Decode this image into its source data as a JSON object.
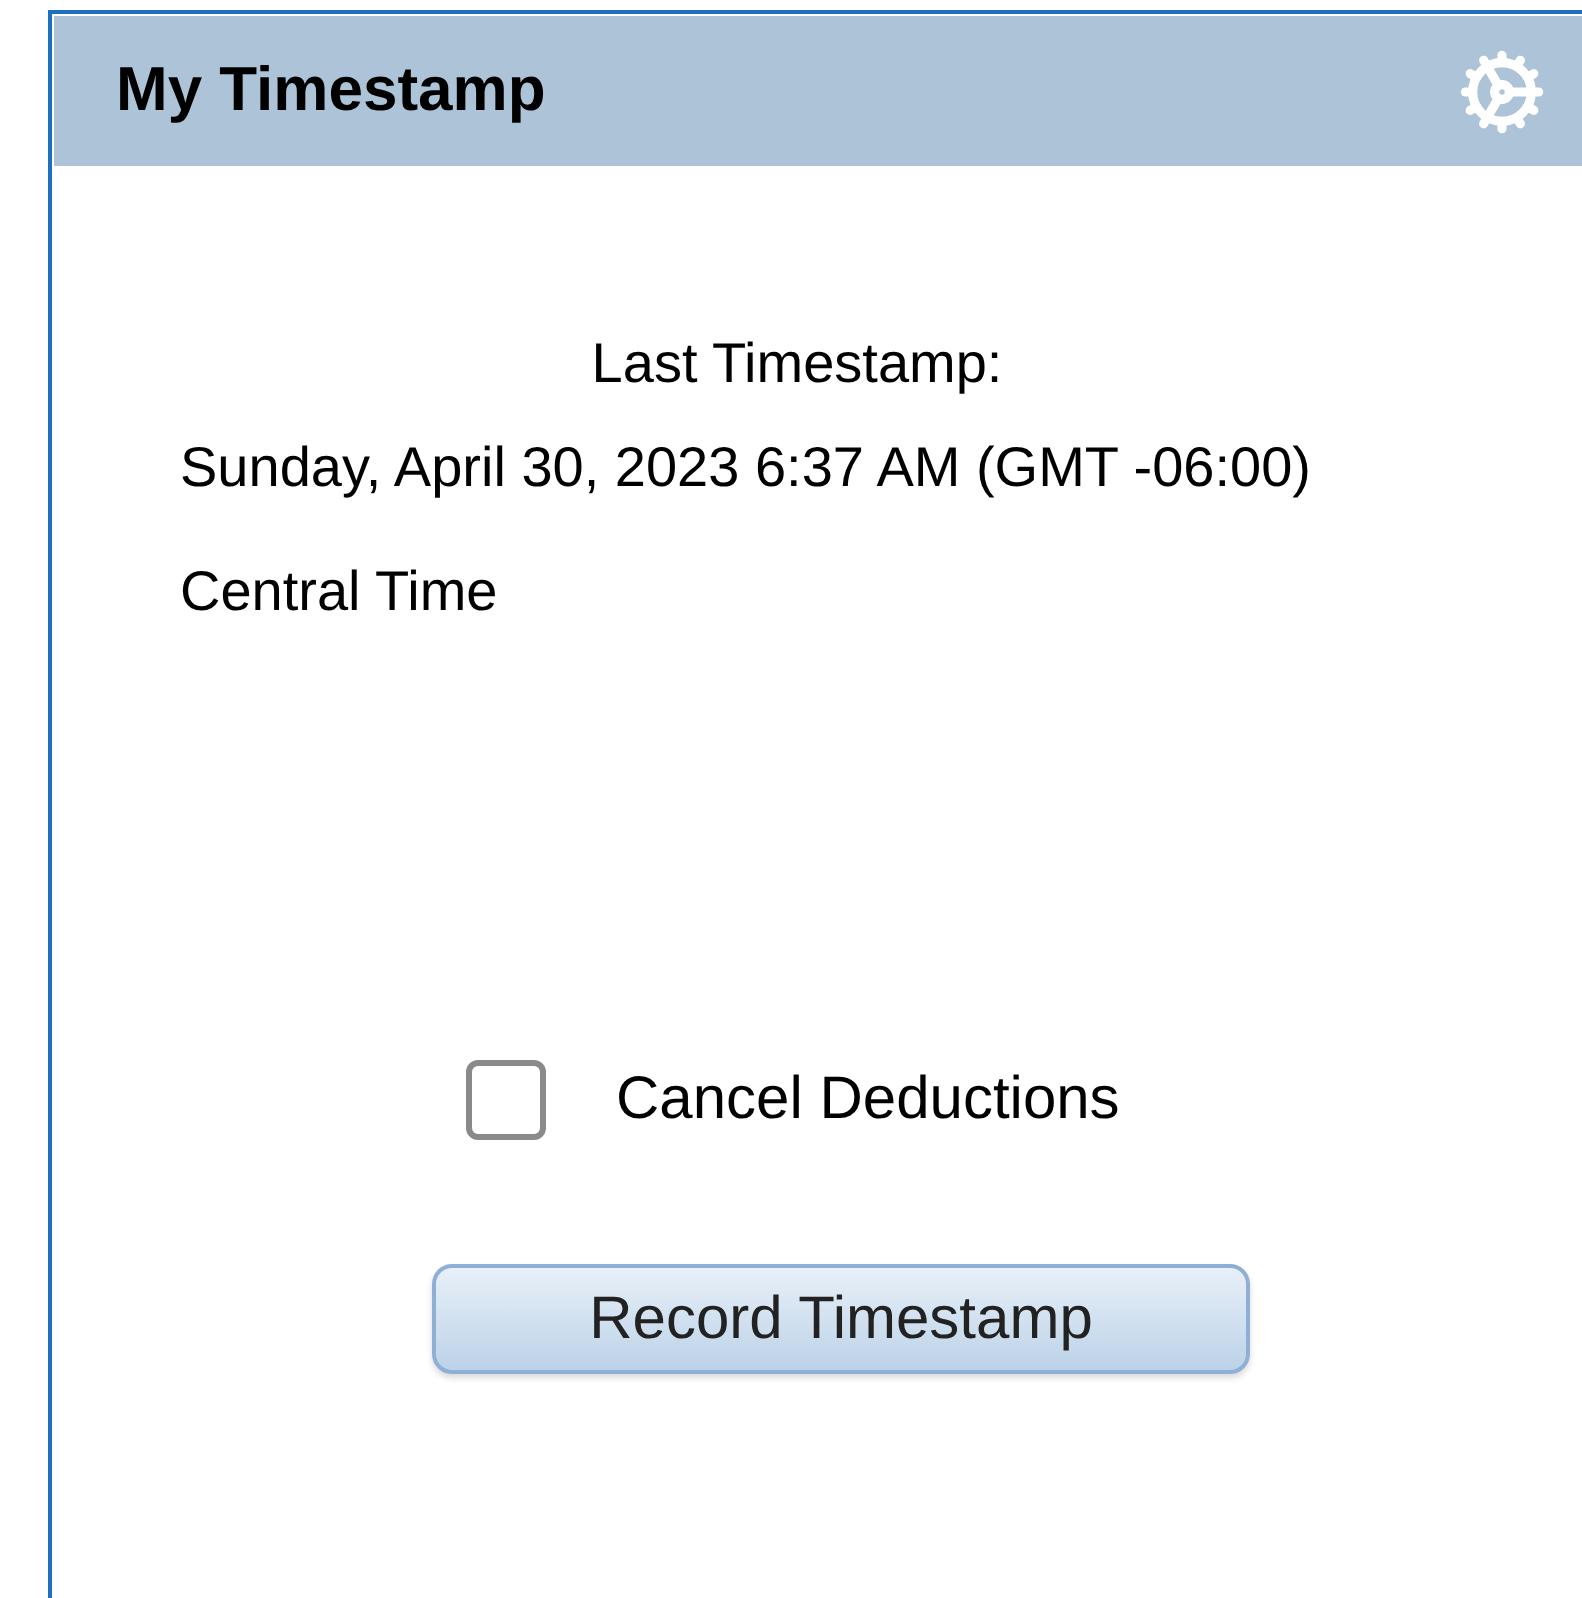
{
  "panel": {
    "title": "My Timestamp"
  },
  "last_timestamp": {
    "label": "Last Timestamp:",
    "value": "Sunday, April 30, 2023 6:37 AM (GMT -06:00) Central Time"
  },
  "checkbox": {
    "label": "Cancel Deductions",
    "checked": false
  },
  "button": {
    "label": "Record Timestamp"
  }
}
